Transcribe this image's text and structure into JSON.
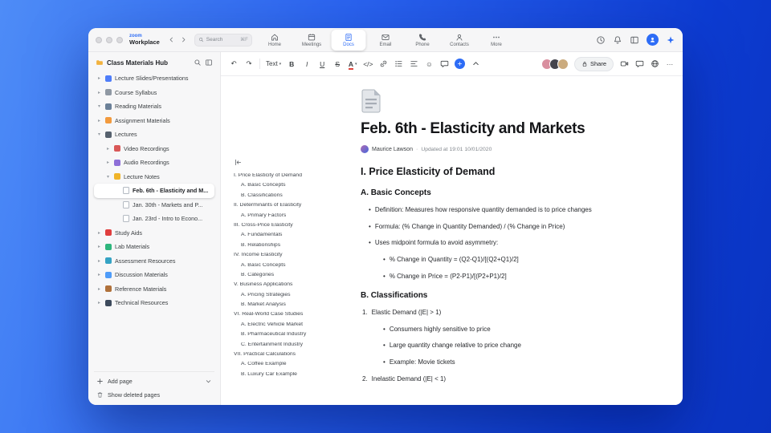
{
  "titlebar": {
    "brand_top": "zoom",
    "brand_bottom": "Workplace",
    "search": {
      "placeholder": "Search",
      "shortcut": "⌘F"
    },
    "tabs": [
      {
        "label": "Home",
        "icon": "home"
      },
      {
        "label": "Meetings",
        "icon": "calendar"
      },
      {
        "label": "Docs",
        "icon": "docs",
        "active": true
      },
      {
        "label": "Email",
        "icon": "mail"
      },
      {
        "label": "Phone",
        "icon": "phone"
      },
      {
        "label": "Contacts",
        "icon": "contacts"
      },
      {
        "label": "More",
        "icon": "more"
      }
    ]
  },
  "sidebar": {
    "title": "Class Materials Hub",
    "items": [
      {
        "label": "Lecture Slides/Presentations",
        "depth": 0,
        "chevron": "right",
        "color": "#4f7df9"
      },
      {
        "label": "Course Syllabus",
        "depth": 0,
        "chevron": "right",
        "color": "#8f98a3"
      },
      {
        "label": "Reading Materials",
        "depth": 0,
        "chevron": "down",
        "color": "#6b8098"
      },
      {
        "label": "Assignment Materials",
        "depth": 0,
        "chevron": "right",
        "color": "#f29a3e"
      },
      {
        "label": "Lectures",
        "depth": 0,
        "chevron": "down",
        "color": "#56616e"
      },
      {
        "label": "Video Recordings",
        "depth": 1,
        "chevron": "right",
        "color": "#d95858"
      },
      {
        "label": "Audio Recordings",
        "depth": 1,
        "chevron": "right",
        "color": "#8e6fd8"
      },
      {
        "label": "Lecture Notes",
        "depth": 1,
        "chevron": "down",
        "color": "#f0b429"
      },
      {
        "label": "Feb. 6th - Elasticity and M...",
        "depth": 2,
        "chevron": "none",
        "page": true,
        "selected": true
      },
      {
        "label": "Jan. 30th - Markets and P...",
        "depth": 2,
        "chevron": "none",
        "page": true
      },
      {
        "label": "Jan. 23rd - Intro to Econo...",
        "depth": 2,
        "chevron": "none",
        "page": true
      },
      {
        "label": "Study Aids",
        "depth": 0,
        "chevron": "right",
        "color": "#e03e3e"
      },
      {
        "label": "Lab Materials",
        "depth": 0,
        "chevron": "right",
        "color": "#2eb67d"
      },
      {
        "label": "Assessment Resources",
        "depth": 0,
        "chevron": "right",
        "color": "#35a3c4"
      },
      {
        "label": "Discussion Materials",
        "depth": 0,
        "chevron": "right",
        "color": "#4f9cf9"
      },
      {
        "label": "Reference Materials",
        "depth": 0,
        "chevron": "right",
        "color": "#b0713b"
      },
      {
        "label": "Technical Resources",
        "depth": 0,
        "chevron": "right",
        "color": "#3d4a5c"
      }
    ],
    "add_page_label": "Add page",
    "show_deleted_label": "Show deleted pages"
  },
  "doc_toolbar": {
    "undo": "↶",
    "redo": "↷",
    "text_style": "Text",
    "bold": "B",
    "italic": "I",
    "underline": "U",
    "strike": "S",
    "color": "A",
    "code": "</>",
    "smiley": "☺",
    "share_label": "Share",
    "more": "···"
  },
  "outline": {
    "items": [
      {
        "label": "I. Price Elasticity of Demand",
        "level": 0
      },
      {
        "label": "A. Basic Concepts",
        "level": 1
      },
      {
        "label": "B. Classifications",
        "level": 1
      },
      {
        "label": "II. Determinants of Elasticity",
        "level": 0
      },
      {
        "label": "A. Primary Factors",
        "level": 1
      },
      {
        "label": "III. Cross-Price Elasticity",
        "level": 0
      },
      {
        "label": "A. Fundamentals",
        "level": 1
      },
      {
        "label": "B. Relationships",
        "level": 1
      },
      {
        "label": "IV. Income Elasticity",
        "level": 0
      },
      {
        "label": "A. Basic Concepts",
        "level": 1
      },
      {
        "label": "B. Categories",
        "level": 1
      },
      {
        "label": "V. Business Applications",
        "level": 0
      },
      {
        "label": "A. Pricing Strategies",
        "level": 1
      },
      {
        "label": "B. Market Analysis",
        "level": 1
      },
      {
        "label": "VI. Real-World Case Studies",
        "level": 0
      },
      {
        "label": "A. Electric Vehicle Market",
        "level": 1
      },
      {
        "label": "B. Pharmaceutical Industry",
        "level": 1
      },
      {
        "label": "C. Entertainment Industry",
        "level": 1
      },
      {
        "label": "VII. Practical Calculations",
        "level": 0
      },
      {
        "label": "A. Coffee Example",
        "level": 1
      },
      {
        "label": "B. Luxury Car Example",
        "level": 1
      }
    ]
  },
  "document": {
    "title": "Feb. 6th - Elasticity and Markets",
    "author": "Maurice Lawson",
    "meta_dot": "·",
    "updated": "Updated at 19:01 10/01/2020",
    "blocks": [
      {
        "type": "h2",
        "text": "I. Price Elasticity of Demand"
      },
      {
        "type": "h3",
        "text": "A. Basic Concepts"
      },
      {
        "type": "li1",
        "marker": "•",
        "text": "Definition: Measures how responsive quantity demanded is to price changes"
      },
      {
        "type": "li1",
        "marker": "•",
        "text": "Formula: (% Change in Quantity Demanded) / (% Change in Price)"
      },
      {
        "type": "li1",
        "marker": "•",
        "text": "Uses midpoint formula to avoid asymmetry:"
      },
      {
        "type": "li2",
        "marker": "•",
        "text": "% Change in Quantity = (Q2-Q1)/[(Q2+Q1)/2]"
      },
      {
        "type": "li2",
        "marker": "•",
        "text": "% Change in Price = (P2-P1)/[(P2+P1)/2]"
      },
      {
        "type": "h3",
        "text": "B. Classifications"
      },
      {
        "type": "ol1",
        "marker": "1.",
        "text": "Elastic Demand (|E| > 1)"
      },
      {
        "type": "li2",
        "marker": "•",
        "text": "Consumers highly sensitive to price"
      },
      {
        "type": "li2",
        "marker": "•",
        "text": "Large quantity change relative to price change"
      },
      {
        "type": "li2",
        "marker": "•",
        "text": "Example: Movie tickets"
      },
      {
        "type": "ol1",
        "marker": "2.",
        "text": "Inelastic Demand (|E| < 1)"
      }
    ]
  },
  "colors": {
    "accent": "#2d6cf6"
  }
}
